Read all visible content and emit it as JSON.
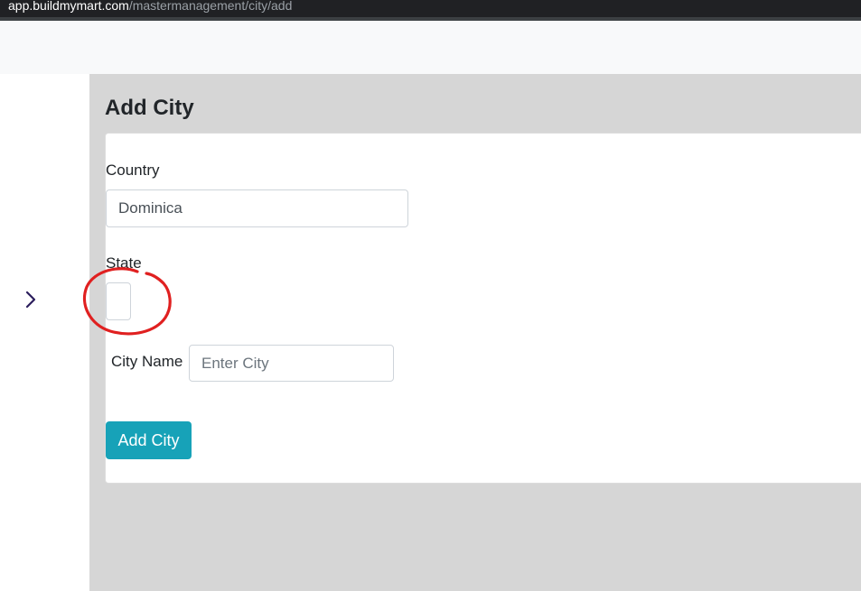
{
  "browser": {
    "url_host": "app.buildmymart.com",
    "url_path": "/mastermanagement/city/add"
  },
  "sidebar": {
    "toggle_icon": "chevron-right-icon"
  },
  "page": {
    "title": "Add City"
  },
  "form": {
    "country_label": "Country",
    "country_value": "Dominica",
    "state_label": "State",
    "state_value": "",
    "city_label": "City Name",
    "city_value": "",
    "city_placeholder": "Enter City",
    "submit_label": "Add City"
  },
  "colors": {
    "primary_button": "#17a2b8",
    "content_background": "#d6d6d6",
    "annotation_circle": "#e02020",
    "sidebar_icon": "#2b1d5c"
  }
}
